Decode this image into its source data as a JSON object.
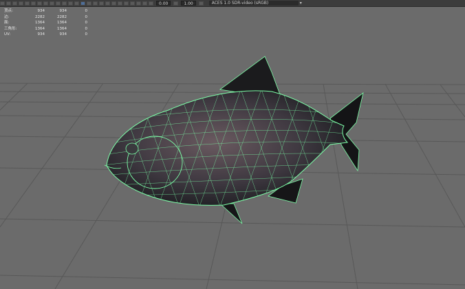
{
  "toolbar": {
    "value1": "0.00",
    "value2": "1.00",
    "color_space": "ACES 1.0 SDR-video (sRGB)"
  },
  "hud": {
    "rows": [
      {
        "label": "顶点:",
        "v1": "934",
        "v2": "934",
        "v3": "0"
      },
      {
        "label": "边:",
        "v1": "2282",
        "v2": "2282",
        "v3": "0"
      },
      {
        "label": "面:",
        "v1": "1364",
        "v2": "1364",
        "v3": "0"
      },
      {
        "label": "三角形:",
        "v1": "1364",
        "v2": "1364",
        "v3": "0"
      },
      {
        "label": "UV:",
        "v1": "934",
        "v2": "934",
        "v3": "0"
      }
    ]
  },
  "colors": {
    "viewport_bg": "#6b6b6b",
    "grid": "#585858",
    "wireframe": "#7dffa8"
  }
}
